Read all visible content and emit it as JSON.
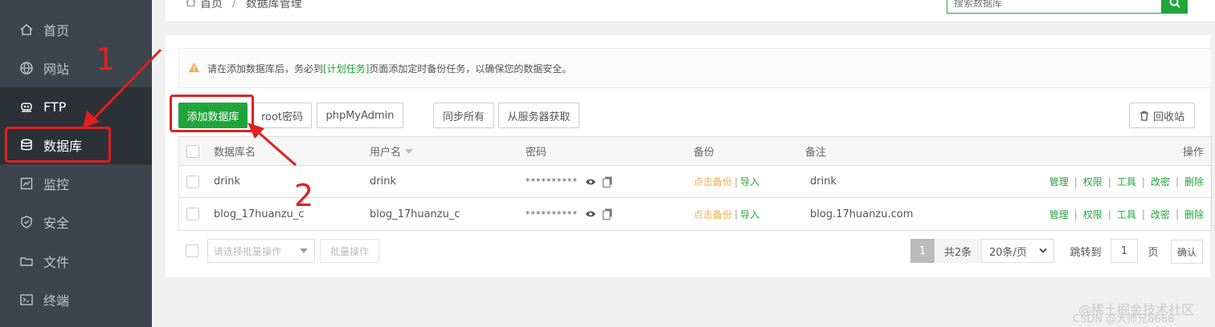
{
  "sidebar": {
    "items": [
      {
        "label": "首页",
        "icon": "home-icon"
      },
      {
        "label": "网站",
        "icon": "globe-icon"
      },
      {
        "label": "FTP",
        "icon": "ftp-icon"
      },
      {
        "label": "数据库",
        "icon": "database-icon"
      },
      {
        "label": "监控",
        "icon": "monitor-icon"
      },
      {
        "label": "安全",
        "icon": "shield-icon"
      },
      {
        "label": "文件",
        "icon": "folder-icon"
      },
      {
        "label": "终端",
        "icon": "terminal-icon"
      }
    ]
  },
  "breadcrumb": {
    "home": "首页",
    "current": "数据库管理"
  },
  "search": {
    "placeholder": "搜索数据库"
  },
  "alert": {
    "before": "请在添加数据库后，务必到",
    "link": "[计划任务]",
    "after": "页面添加定时备份任务，以确保您的数据安全。"
  },
  "toolbar": {
    "add_db": "添加数据库",
    "root_pwd": "root密码",
    "phpmyadmin": "phpMyAdmin",
    "sync_all": "同步所有",
    "fetch_server": "从服务器获取",
    "recycle": "回收站"
  },
  "table": {
    "headers": {
      "name": "数据库名",
      "user": "用户名",
      "password": "密码",
      "backup": "备份",
      "note": "备注",
      "ops": "操作"
    },
    "rows": [
      {
        "name": "drink",
        "user": "drink",
        "password": "**********",
        "backup": "点击备份",
        "import": "导入",
        "note": "drink"
      },
      {
        "name": "blog_17huanzu_c",
        "user": "blog_17huanzu_c",
        "password": "**********",
        "backup": "点击备份",
        "import": "导入",
        "note": "blog.17huanzu.com"
      }
    ],
    "ops": [
      "管理",
      "权限",
      "工具",
      "改密",
      "删除"
    ],
    "pipe": "|"
  },
  "footer": {
    "batch_select": "请选择批量操作",
    "batch_btn": "批量操作",
    "page": "1",
    "total": "共2条",
    "per_page": "20条/页",
    "jump_to": "跳转到",
    "jump_value": "1",
    "page_unit": "页",
    "confirm": "确认"
  },
  "annotations": {
    "one": "1",
    "two": "2"
  },
  "watermark": {
    "line1": "@稀土掘金技术社区",
    "line2": "CSDN @大师兄6668"
  },
  "colors": {
    "accent": "#20a53a",
    "warning": "#f0ad4e",
    "annotation": "#e02020",
    "sidebar": "#3c444d"
  }
}
